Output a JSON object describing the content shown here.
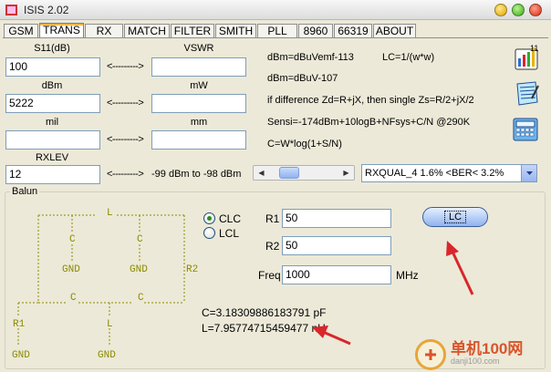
{
  "window": {
    "title": "ISIS 2.02"
  },
  "tabs": [
    {
      "label": "GSM",
      "active": false
    },
    {
      "label": "TRANS",
      "active": true
    },
    {
      "label": "RX",
      "active": false
    },
    {
      "label": "MATCH",
      "active": false
    },
    {
      "label": "FILTER",
      "active": false
    },
    {
      "label": "SMITH",
      "active": false
    },
    {
      "label": "PLL",
      "active": false
    },
    {
      "label": "8960",
      "active": false
    },
    {
      "label": "66319",
      "active": false
    },
    {
      "label": "ABOUT",
      "active": false
    }
  ],
  "trans": {
    "s11_label": "S11(dB)",
    "s11_value": "100",
    "vswr_label": "VSWR",
    "vswr_value": "",
    "dbm_label": "dBm",
    "dbm_value": "5222",
    "mw_label": "mW",
    "mw_value": "",
    "mil_label": "mil",
    "mil_value": "",
    "mm_label": "mm",
    "mm_value": "",
    "rxlev_label": "RXLEV",
    "rxlev_value": "12",
    "arrow": "<--------->",
    "rxlev_range": "-99 dBm  to  -98 dBm",
    "rxqual_selected": "RXQUAL_4    1.6%  <BER<  3.2%"
  },
  "formulas": {
    "f1": "dBm=dBuVemf-113",
    "f1b": "LC=1/(w*w)",
    "f2": "dBm=dBuV-107",
    "f3": "if difference Zd=R+jX, then single Zs=R/2+jX/2",
    "f4": "Sensi=-174dBm+10logB+NFsys+C/N  @290K",
    "f5": "C=W*log(1+S/N)"
  },
  "side_icons": [
    "calculator-chart-icon",
    "notepad-icon",
    "calculator-icon"
  ],
  "balun": {
    "title": "Balun",
    "radio_clc": "CLC",
    "radio_lcl": "LCL",
    "r1_label": "R1",
    "r1_value": "50",
    "r2_label": "R2",
    "r2_value": "50",
    "freq_label": "Freq",
    "freq_value": "1000",
    "freq_unit": "MHz",
    "lc_button": "LC",
    "result_c": "C=3.18309886183791 pF",
    "result_l": "L=7.95774715459477 nH",
    "schematic": {
      "L": "L",
      "C": "C",
      "GND": "GND",
      "R1": "R1",
      "R2": "R2"
    }
  },
  "watermark": {
    "text": "单机100网",
    "sub": "danji100.com"
  },
  "colors": {
    "schematic": "#8b8b00",
    "arrow_annotation": "#d9262c",
    "tab_highlight": "#f5b64a"
  }
}
